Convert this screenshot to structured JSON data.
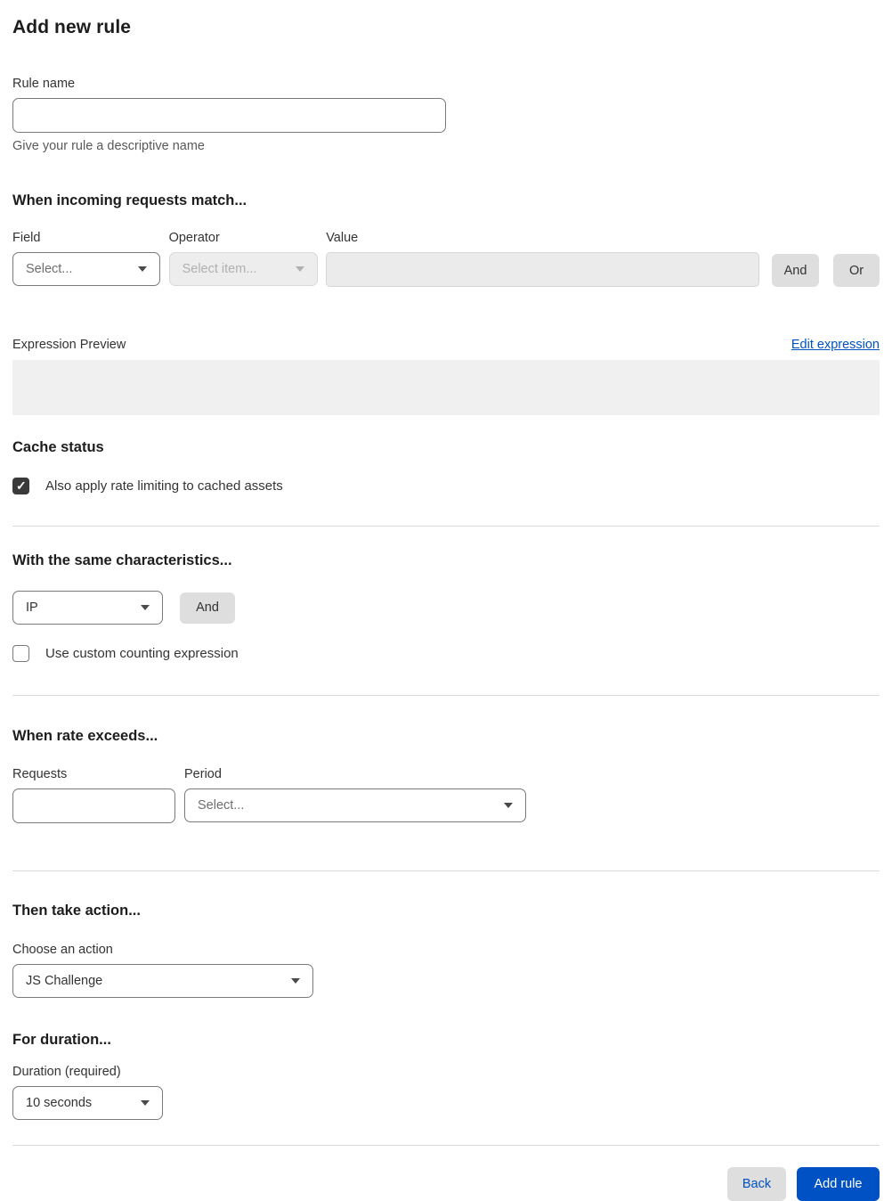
{
  "page": {
    "title": "Add new rule"
  },
  "rule_name": {
    "label": "Rule name",
    "value": "",
    "helper": "Give your rule a descriptive name"
  },
  "match": {
    "heading": "When incoming requests match...",
    "field": {
      "label": "Field",
      "selected": "Select..."
    },
    "operator": {
      "label": "Operator",
      "selected": "Select item..."
    },
    "value": {
      "label": "Value",
      "value": ""
    },
    "and_label": "And",
    "or_label": "Or",
    "expression_preview_label": "Expression Preview",
    "edit_expression_label": "Edit expression",
    "expression_value": ""
  },
  "cache": {
    "heading": "Cache status",
    "checkbox_label": "Also apply rate limiting to cached assets",
    "checked": true
  },
  "characteristics": {
    "heading": "With the same characteristics...",
    "selected": "IP",
    "and_label": "And",
    "custom_counting_label": "Use custom counting expression",
    "custom_counting_checked": false
  },
  "rate": {
    "heading": "When rate exceeds...",
    "requests_label": "Requests",
    "requests_value": "",
    "period_label": "Period",
    "period_selected": "Select..."
  },
  "action": {
    "heading": "Then take action...",
    "choose_label": "Choose an action",
    "selected": "JS Challenge"
  },
  "duration": {
    "heading": "For duration...",
    "label": "Duration (required)",
    "selected": "10 seconds"
  },
  "footer": {
    "back_label": "Back",
    "submit_label": "Add rule"
  },
  "colors": {
    "primary_blue": "#0051c3",
    "checkbox_checked": "#3a3a3a",
    "button_gray": "#dedede",
    "preview_box": "#f0f0f0"
  }
}
